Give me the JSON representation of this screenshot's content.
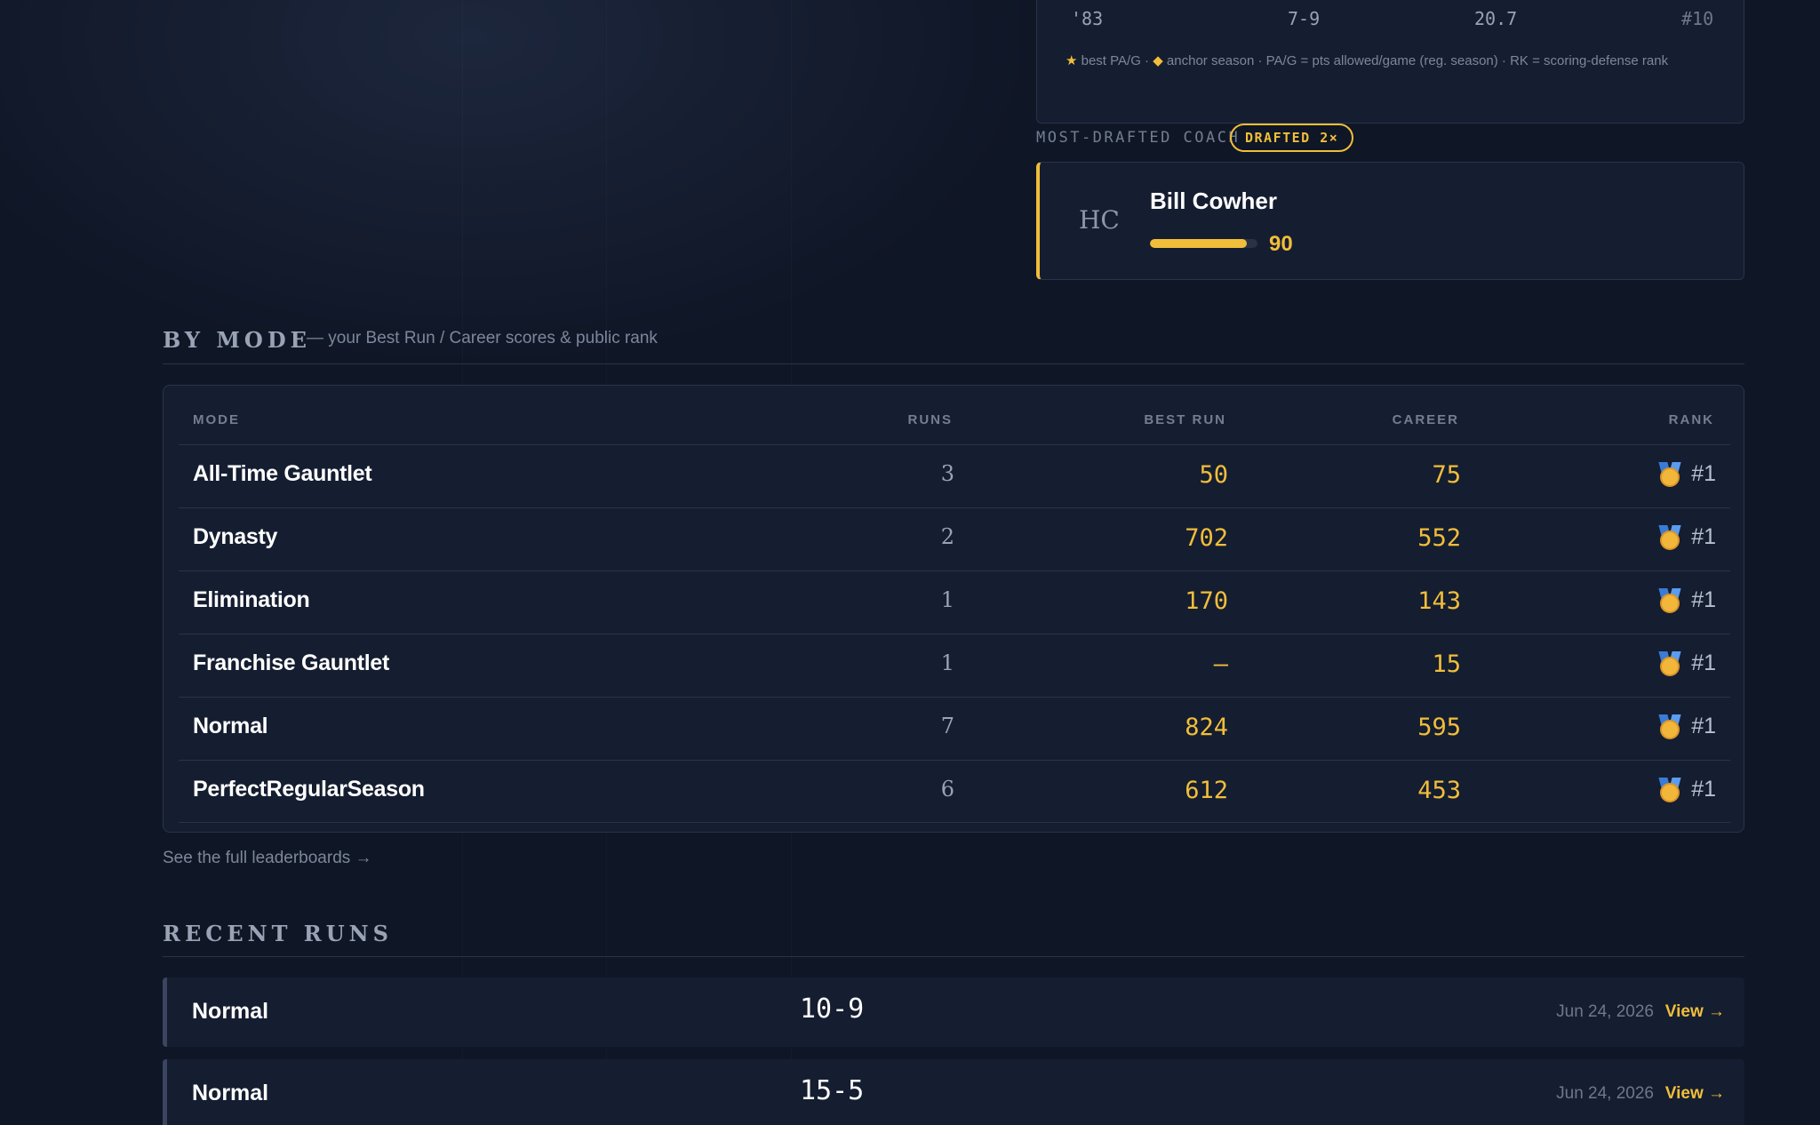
{
  "season": {
    "year": "'83",
    "record": "7-9",
    "pa_per_game": "20.7",
    "rank": "#10",
    "legend_star": "★",
    "legend_diamond": "◆",
    "legend_text_1": " best PA/G · ",
    "legend_text_2": " anchor season · PA/G = pts allowed/game (reg. season) · RK = scoring-defense rank"
  },
  "coach": {
    "label": "MOST-DRAFTED COACH",
    "badge": "DRAFTED 2×",
    "position": "HC",
    "name": "Bill Cowher",
    "score": "90",
    "score_value": 90
  },
  "by_mode": {
    "title": "BY MODE",
    "subtitle": "— your Best Run / Career scores & public rank",
    "headers": {
      "mode": "MODE",
      "runs": "RUNS",
      "best": "BEST RUN",
      "career": "CAREER",
      "rank": "RANK"
    },
    "rows": [
      {
        "mode": "All-Time Gauntlet",
        "runs": "3",
        "best": "50",
        "career": "75",
        "rank": "#1"
      },
      {
        "mode": "Dynasty",
        "runs": "2",
        "best": "702",
        "career": "552",
        "rank": "#1"
      },
      {
        "mode": "Elimination",
        "runs": "1",
        "best": "170",
        "career": "143",
        "rank": "#1"
      },
      {
        "mode": "Franchise Gauntlet",
        "runs": "1",
        "best": "—",
        "career": "15",
        "rank": "#1"
      },
      {
        "mode": "Normal",
        "runs": "7",
        "best": "824",
        "career": "595",
        "rank": "#1"
      },
      {
        "mode": "PerfectRegularSeason",
        "runs": "6",
        "best": "612",
        "career": "453",
        "rank": "#1"
      }
    ],
    "leaderboard_link": "See the full leaderboards →"
  },
  "recent_runs": {
    "title": "RECENT RUNS",
    "runs": [
      {
        "mode": "Normal",
        "record": "10-9",
        "date": "Jun 24, 2026",
        "view": "View →"
      },
      {
        "mode": "Normal",
        "record": "15-5",
        "date": "Jun 24, 2026",
        "view": "View →"
      }
    ]
  },
  "colors": {
    "accent": "#f0be3a",
    "background": "#0f1626",
    "card": "#151d30"
  }
}
